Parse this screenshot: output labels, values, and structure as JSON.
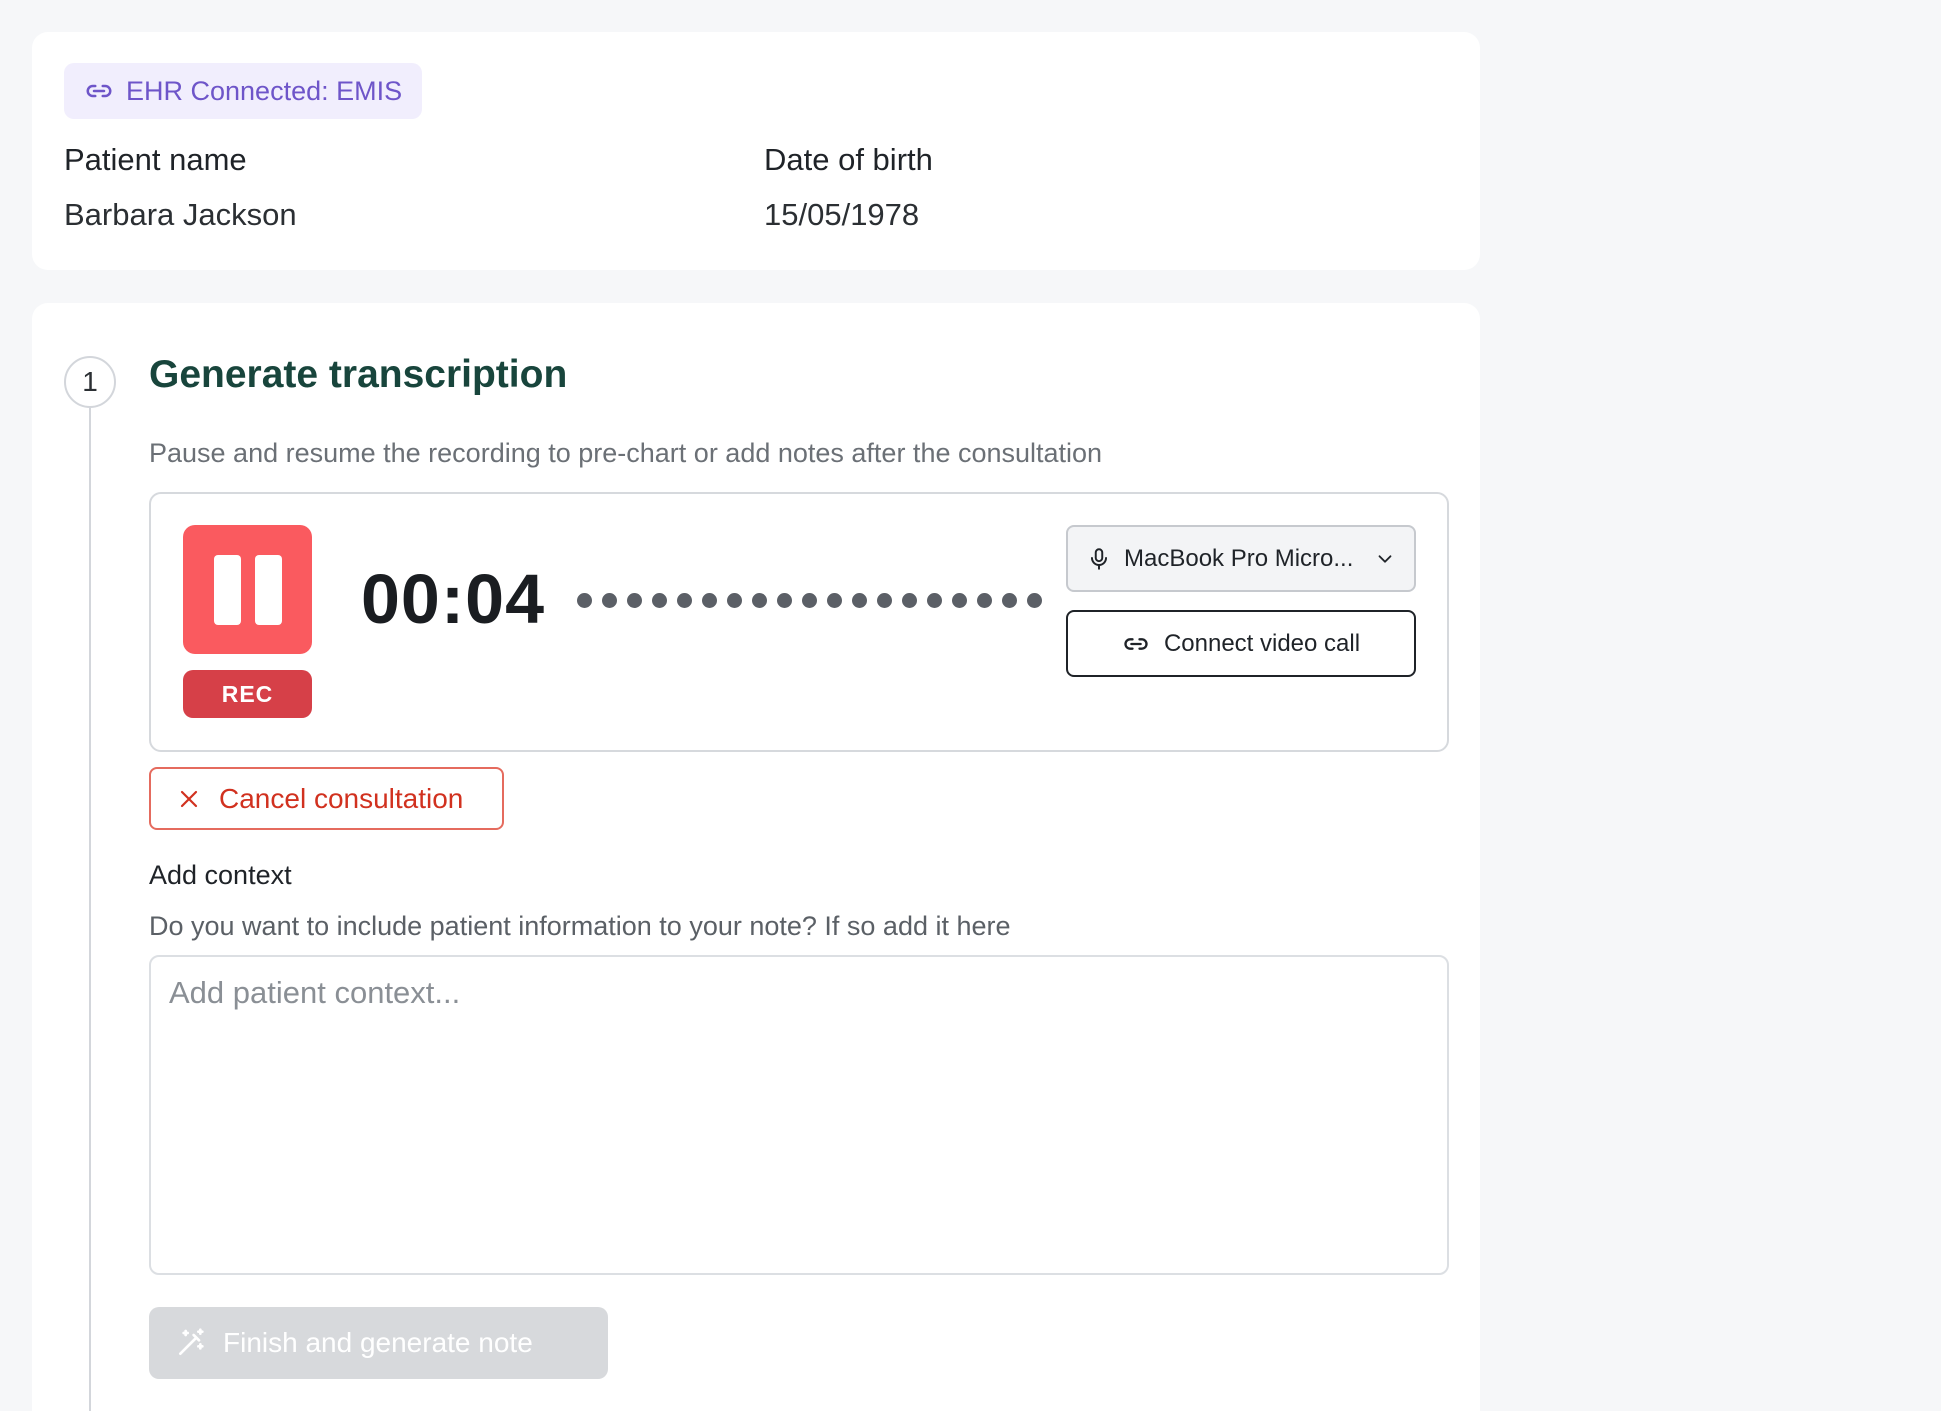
{
  "ehr_badge": {
    "label": "EHR Connected: EMIS",
    "icon": "link-icon",
    "color": "#6e55c9"
  },
  "patient": {
    "name_label": "Patient name",
    "name_value": "Barbara Jackson",
    "dob_label": "Date of birth",
    "dob_value": "15/05/1978"
  },
  "step": {
    "number": "1",
    "title": "Generate transcription",
    "description": "Pause and resume the recording to pre-chart or add notes after the consultation"
  },
  "recorder": {
    "rec_label": "REC",
    "timer": "00:04",
    "rec_color": "#fa5a5f",
    "microphone": {
      "selected": "MacBook Pro Micro...",
      "icon": "microphone-icon"
    },
    "video_call_label": "Connect video call"
  },
  "cancel": {
    "label": "Cancel consultation",
    "icon": "close-icon",
    "color": "#d1311f"
  },
  "context": {
    "title": "Add context",
    "description": "Do you want to include patient information to your note? If so add it here",
    "placeholder": "Add patient context...",
    "value": ""
  },
  "finish": {
    "label": "Finish and generate note",
    "icon": "magic-wand-icon",
    "disabled": true
  }
}
